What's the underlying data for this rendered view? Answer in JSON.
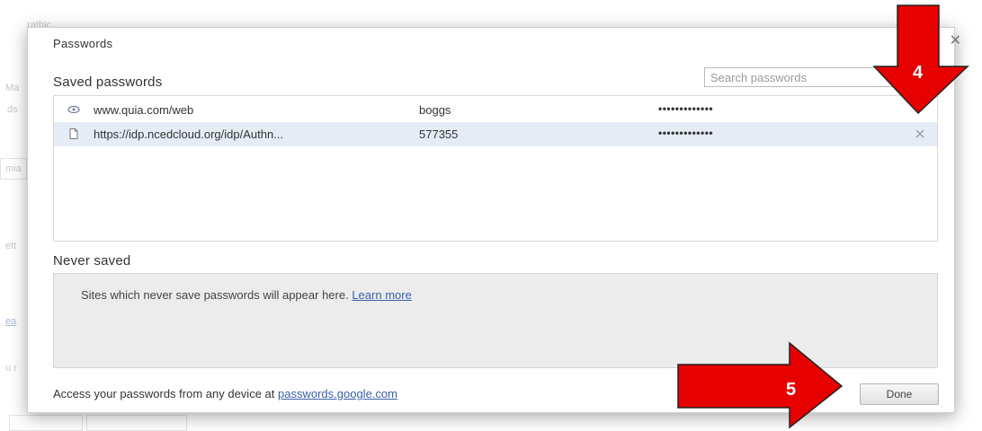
{
  "background_fragments": [
    "rathic",
    "Ma",
    "ds",
    "mia",
    "ett",
    "ea",
    "u r"
  ],
  "dialog": {
    "title": "Passwords",
    "close_icon": "close-icon"
  },
  "saved": {
    "heading": "Saved passwords",
    "search_placeholder": "Search passwords",
    "rows": [
      {
        "site": "www.quia.com/web",
        "user": "boggs",
        "password": "•••••••••••••",
        "icon": "site-favicon-icon",
        "selected": false
      },
      {
        "site": "https://idp.ncedcloud.org/idp/Authn...",
        "user": "577355",
        "password": "•••••••••••••",
        "icon": "page-icon",
        "selected": true
      }
    ]
  },
  "never": {
    "heading": "Never saved",
    "message": "Sites which never save passwords will appear here.",
    "learn_more": "Learn more"
  },
  "footer": {
    "text": "Access your passwords from any device at",
    "link": "passwords.google.com",
    "done_label": "Done"
  },
  "annotations": {
    "step_4": "4",
    "step_5": "5",
    "arrow_color": "#e60000"
  }
}
